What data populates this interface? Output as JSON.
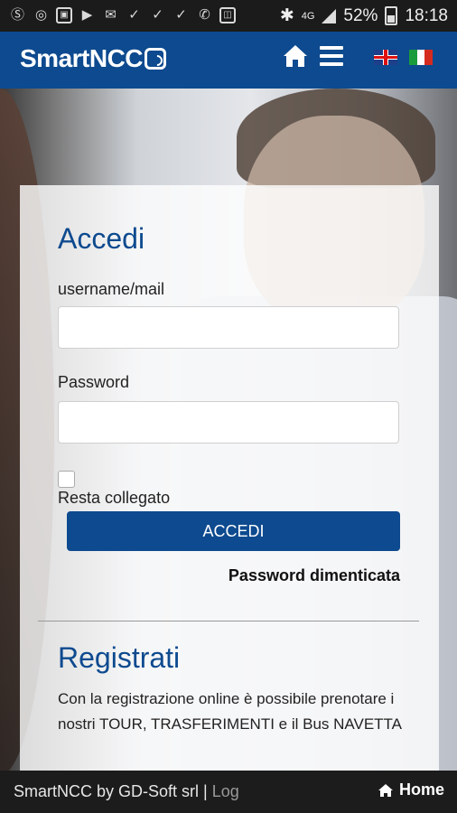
{
  "status_bar": {
    "battery": "52%",
    "time": "18:18",
    "network": "4G"
  },
  "header": {
    "logo_text": "SmartNCC",
    "languages": [
      "English",
      "Italiano"
    ]
  },
  "login": {
    "title": "Accedi",
    "username_label": "username/mail",
    "username_value": "",
    "password_label": "Password",
    "password_value": "",
    "remember_label": "Resta collegato",
    "submit_label": "ACCEDI",
    "forgot_label": "Password dimenticata"
  },
  "register": {
    "title": "Registrati",
    "text": "Con la registrazione online è possibile prenotare i nostri TOUR, TRASFERIMENTI e il Bus NAVETTA"
  },
  "footer": {
    "credit": "SmartNCC by GD-Soft srl",
    "separator": "|",
    "log_label": "Log",
    "home_label": "Home"
  },
  "colors": {
    "brand": "#0d4a8f",
    "status_bar": "#1b1b1b",
    "footer": "#1c1c1c"
  }
}
